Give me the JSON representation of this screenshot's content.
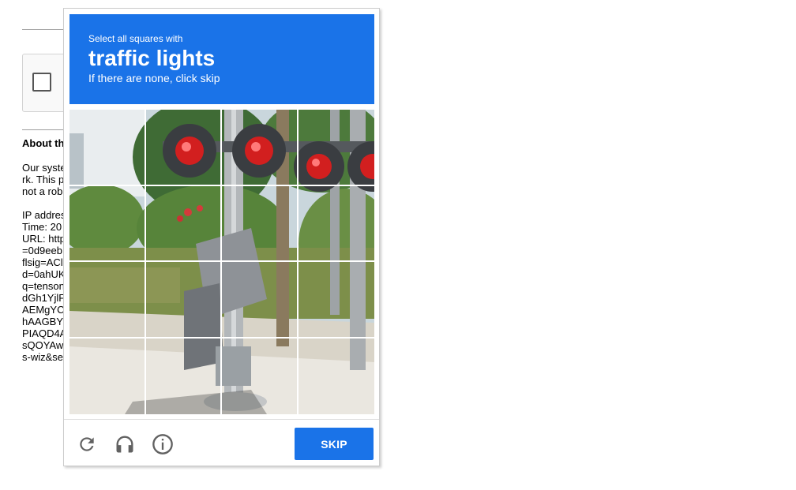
{
  "background_page": {
    "heading": "About th",
    "paragraph_lines": [
      "Our syste",
      "rk. This p",
      "not a rob"
    ],
    "meta_lines": [
      "IP addres",
      "Time: 20",
      "URL: http",
      "=0d9eeb",
      "flsig=ACl",
      "d=0ahUK",
      "q=tenson",
      "dGh1YjlF",
      "AEMgYC",
      "hAAGBY",
      "PIAQD4A",
      "sQOYAw",
      "s-wiz&se"
    ]
  },
  "challenge": {
    "instruction_prefix": "Select all squares with",
    "target_object": "traffic lights",
    "hint": "If there are none, click skip",
    "grid_rows": 4,
    "grid_cols": 4,
    "skip_label": "SKIP",
    "icons": [
      "reload-icon",
      "audio-headphones-icon",
      "info-icon"
    ]
  },
  "colors": {
    "accent": "#1a73e8",
    "signal_red": "#d21f1f",
    "icon_gray": "#616161"
  }
}
